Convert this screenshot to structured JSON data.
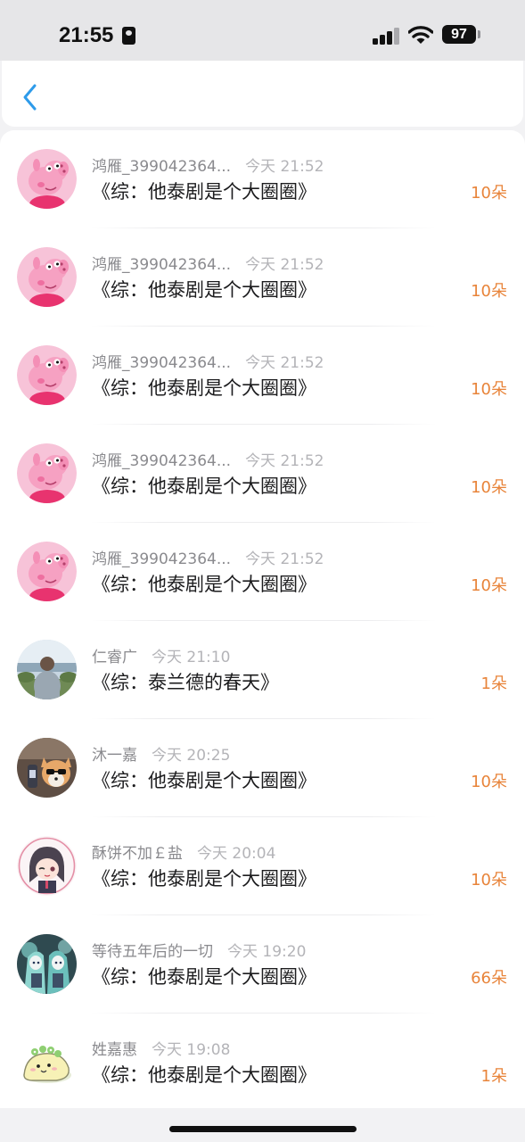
{
  "status_bar": {
    "time": "21:55",
    "battery": "97"
  },
  "records": [
    {
      "user": "鸿雁_399042364...",
      "time": "今天 21:52",
      "title": "《综：他泰剧是个大圈圈》",
      "gift": "10朵",
      "avatar": "pig"
    },
    {
      "user": "鸿雁_399042364...",
      "time": "今天 21:52",
      "title": "《综：他泰剧是个大圈圈》",
      "gift": "10朵",
      "avatar": "pig"
    },
    {
      "user": "鸿雁_399042364...",
      "time": "今天 21:52",
      "title": "《综：他泰剧是个大圈圈》",
      "gift": "10朵",
      "avatar": "pig"
    },
    {
      "user": "鸿雁_399042364...",
      "time": "今天 21:52",
      "title": "《综：他泰剧是个大圈圈》",
      "gift": "10朵",
      "avatar": "pig"
    },
    {
      "user": "鸿雁_399042364...",
      "time": "今天 21:52",
      "title": "《综：他泰剧是个大圈圈》",
      "gift": "10朵",
      "avatar": "pig"
    },
    {
      "user": "仁睿广",
      "time": "今天 21:10",
      "title": "《综：泰兰德的春天》",
      "gift": "1朵",
      "avatar": "person-back"
    },
    {
      "user": "沐一嘉",
      "time": "今天 20:25",
      "title": "《综：他泰剧是个大圈圈》",
      "gift": "10朵",
      "avatar": "dog"
    },
    {
      "user": "酥饼不加￡盐",
      "time": "今天 20:04",
      "title": "《综：他泰剧是个大圈圈》",
      "gift": "10朵",
      "avatar": "anime-girl"
    },
    {
      "user": "等待五年后的一切",
      "time": "今天 19:20",
      "title": "《综：他泰剧是个大圈圈》",
      "gift": "66朵",
      "avatar": "anime-teal"
    },
    {
      "user": "姓嘉惠",
      "time": "今天 19:08",
      "title": "《综：他泰剧是个大圈圈》",
      "gift": "1朵",
      "avatar": "cartoon-creature"
    }
  ]
}
